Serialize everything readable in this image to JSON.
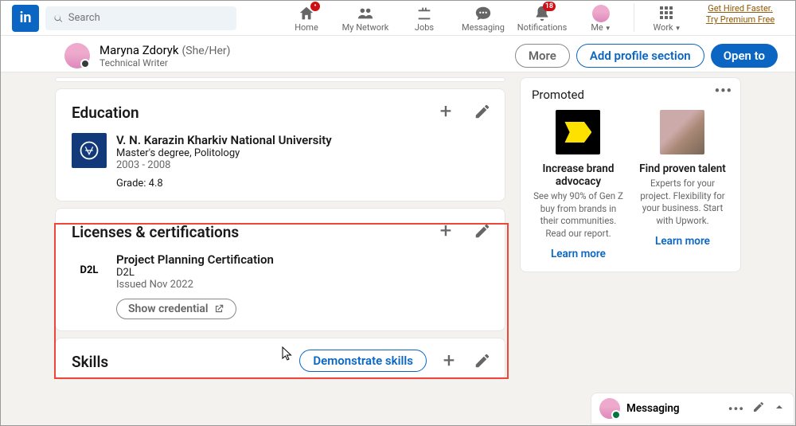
{
  "nav": {
    "search_placeholder": "Search",
    "home": "Home",
    "network": "My Network",
    "jobs": "Jobs",
    "messaging": "Messaging",
    "notifications": "Notifications",
    "notif_badge": "18",
    "me": "Me",
    "work": "Work",
    "premium_line1": "Get Hired Faster.",
    "premium_line2": "Try Premium Free"
  },
  "profile": {
    "name": "Maryna Zdoryk",
    "pronouns": "(She/Her)",
    "role": "Technical Writer",
    "more": "More",
    "add_section": "Add profile section",
    "open_to": "Open to"
  },
  "education": {
    "title": "Education",
    "entry": {
      "school": "V. N. Karazin Kharkiv National University",
      "degree": "Master's degree, Politology",
      "years": "2003 - 2008",
      "grade": "Grade: 4.8"
    }
  },
  "licenses": {
    "title": "Licenses & certifications",
    "entry": {
      "name": "Project Planning Certification",
      "issuer": "D2L",
      "issued": "Issued Nov 2022",
      "show": "Show credential",
      "logo_text": "D2L"
    }
  },
  "skills": {
    "title": "Skills",
    "demo_btn": "Demonstrate skills"
  },
  "promo": {
    "title": "Promoted",
    "items": [
      {
        "heading": "Increase brand advocacy",
        "desc": "See why 90% of Gen Z buy from brands in their communities. Read our report.",
        "link": "Learn more"
      },
      {
        "heading": "Find proven talent",
        "desc": "Experts for your project. Flexibility for your business. Start with Upwork.",
        "link": "Learn more"
      }
    ]
  },
  "messaging": {
    "label": "Messaging"
  }
}
